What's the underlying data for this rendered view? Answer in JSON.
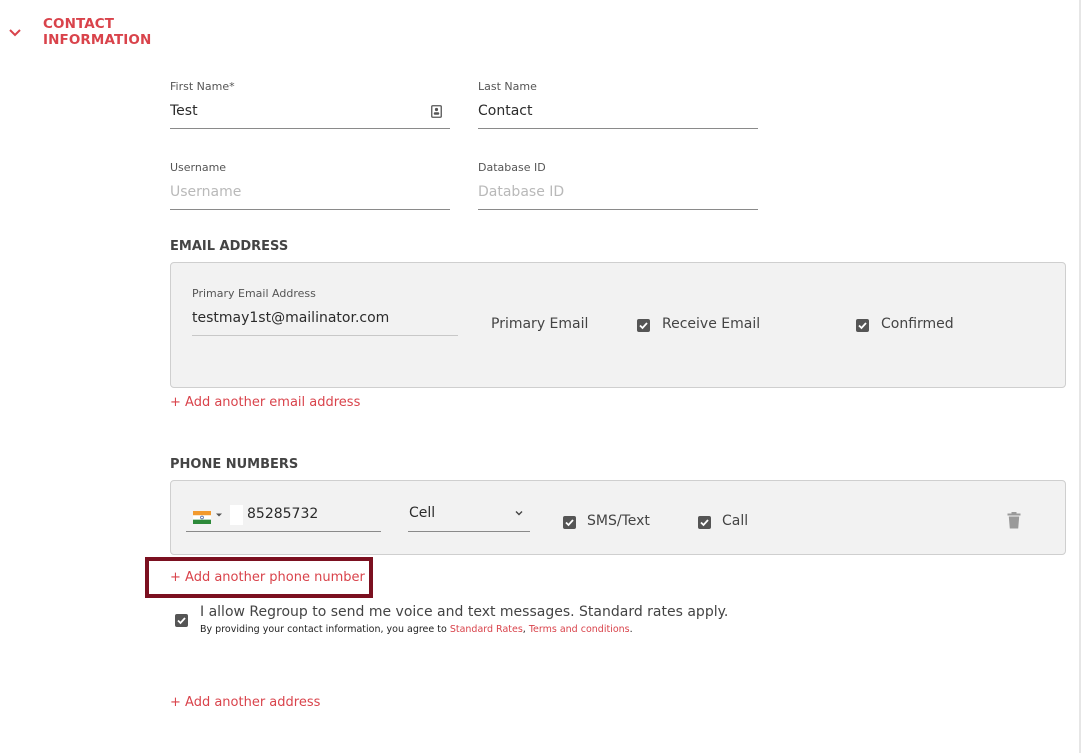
{
  "section": {
    "title_line1": "CONTACT",
    "title_line2": "INFORMATION",
    "chevron_icon": "chevron-down-icon"
  },
  "fields": {
    "first_name": {
      "label": "First Name*",
      "value": "Test",
      "icon": "contact-card-icon"
    },
    "last_name": {
      "label": "Last Name",
      "value": "Contact"
    },
    "username": {
      "label": "Username",
      "value": "",
      "placeholder": "Username"
    },
    "database_id": {
      "label": "Database ID",
      "value": "",
      "placeholder": "Database ID"
    }
  },
  "email": {
    "heading": "EMAIL ADDRESS",
    "primary_label": "Primary Email Address",
    "primary_value": "testmay1st@mailinator.com",
    "primary_tag": "Primary Email",
    "receive_label": "Receive Email",
    "receive_checked": true,
    "confirmed_label": "Confirmed",
    "confirmed_checked": true,
    "add_link": "+ Add another email address"
  },
  "phone": {
    "heading": "PHONE NUMBERS",
    "country_flag": "india-flag-icon",
    "number": "85285732",
    "type_selected": "Cell",
    "sms_label": "SMS/Text",
    "sms_checked": true,
    "call_label": "Call",
    "call_checked": true,
    "delete_icon": "trash-icon",
    "add_link": "+ Add another phone number"
  },
  "consent": {
    "checked": true,
    "main_text": "I allow Regroup to send me voice and text messages. Standard rates apply.",
    "fine_print_prefix": "By providing your contact information, you agree to ",
    "rates_link": "Standard Rates",
    "separator": ", ",
    "terms_link": "Terms and conditions",
    "suffix": "."
  },
  "address": {
    "add_link": "+ Add another address"
  },
  "colors": {
    "accent": "#d9434b",
    "highlight_border": "#7b1020",
    "card_bg": "#f2f2f2"
  }
}
